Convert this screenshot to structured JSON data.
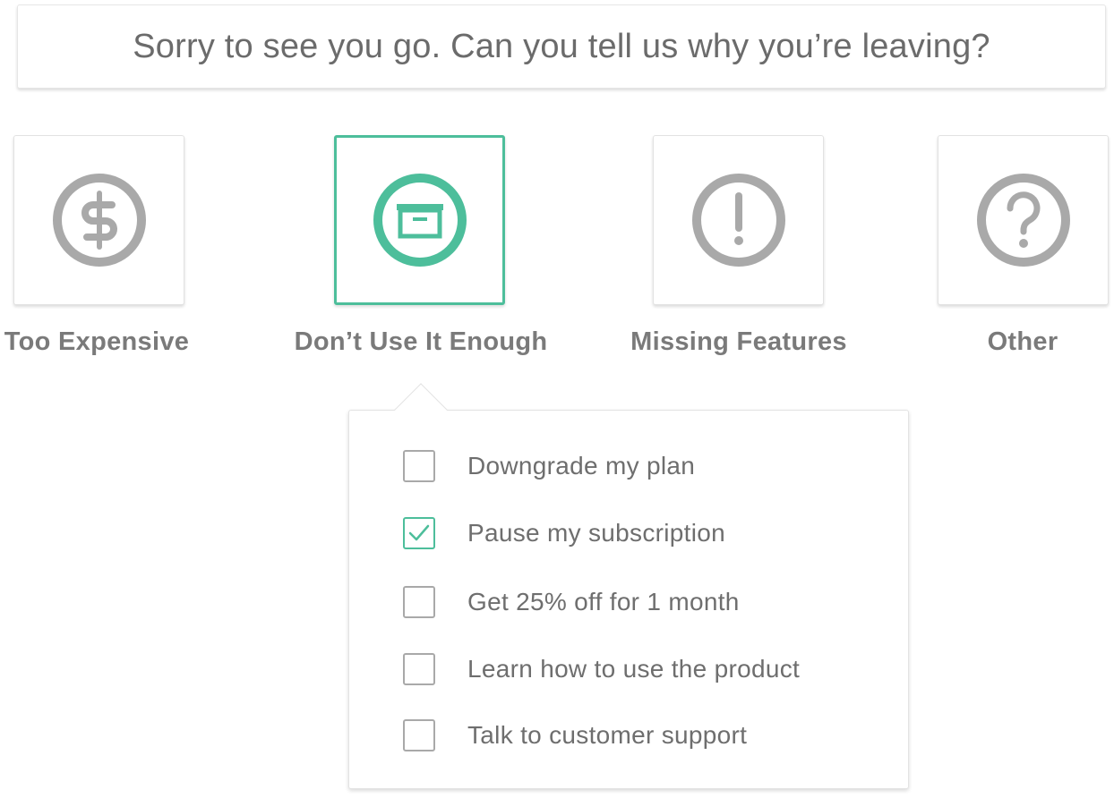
{
  "header": {
    "title": "Sorry to see you go. Can you tell us why you’re leaving?"
  },
  "colors": {
    "accent": "#4dbe9b",
    "icon_gray": "#a9a9a9",
    "text_gray": "#7a7a7a"
  },
  "reasons": [
    {
      "label": "Too Expensive",
      "icon": "dollar-icon",
      "selected": false
    },
    {
      "label": "Don’t Use It Enough",
      "icon": "archive-box-icon",
      "selected": true
    },
    {
      "label": "Missing Features",
      "icon": "exclamation-icon",
      "selected": false
    },
    {
      "label": "Other",
      "icon": "question-icon",
      "selected": false
    }
  ],
  "options": [
    {
      "label": "Downgrade my plan",
      "checked": false
    },
    {
      "label": "Pause my subscription",
      "checked": true
    },
    {
      "label": "Get 25% off for 1 month",
      "checked": false
    },
    {
      "label": "Learn how to use the product",
      "checked": false
    },
    {
      "label": "Talk to customer support",
      "checked": false
    }
  ]
}
